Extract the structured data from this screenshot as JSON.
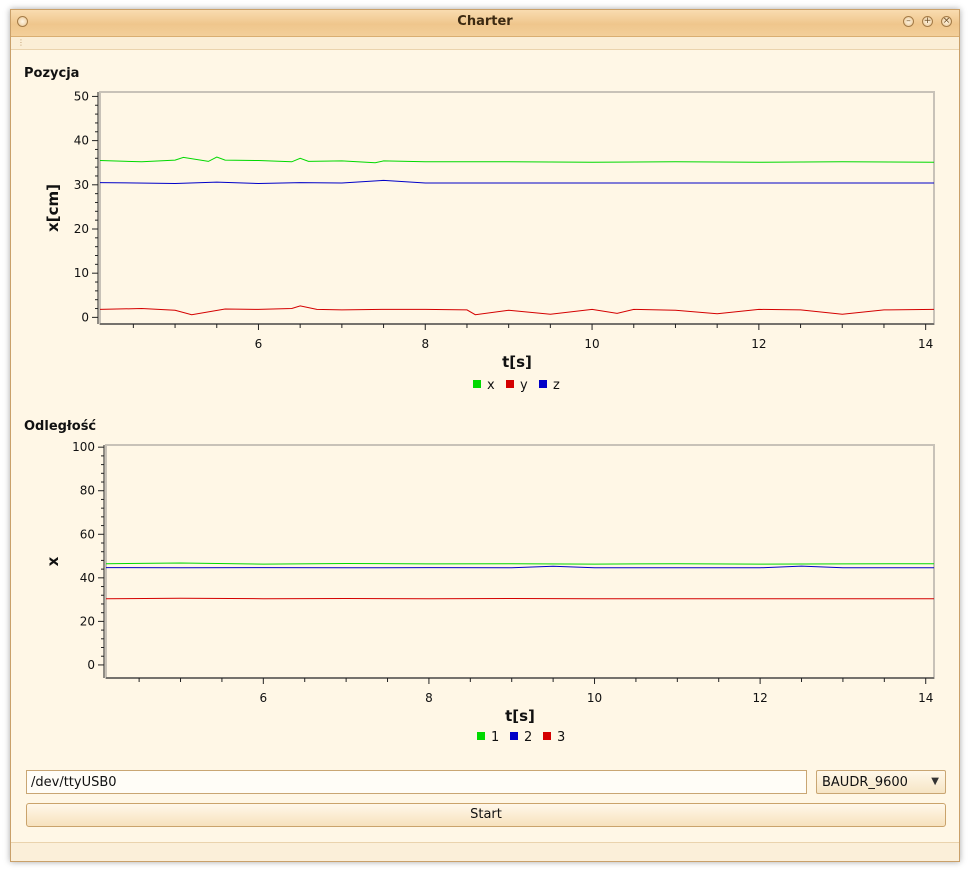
{
  "window": {
    "title": "Charter"
  },
  "colors": {
    "green": "#00d900",
    "red": "#d40000",
    "blue": "#0000c8",
    "axis": "#222222",
    "frame": "#c8c2b8"
  },
  "top_chart": {
    "section_label": "Pozycja",
    "chart_data": {
      "type": "line",
      "title": "",
      "xlabel": "t[s]",
      "ylabel": "x[cm]",
      "xlim": [
        4.1,
        14.1
      ],
      "ylim": [
        -1.5,
        51
      ],
      "x_ticks": [
        6,
        8,
        10,
        12,
        14
      ],
      "y_ticks": [
        0,
        10,
        20,
        30,
        40,
        50
      ],
      "legend": "bottom",
      "series": [
        {
          "name": "x",
          "color": "#00d900",
          "x": [
            4.1,
            4.6,
            5.0,
            5.1,
            5.4,
            5.5,
            5.6,
            6.0,
            6.4,
            6.5,
            6.6,
            7.0,
            7.4,
            7.5,
            8.0,
            9.0,
            10.0,
            11.0,
            12.0,
            13.0,
            14.1
          ],
          "y": [
            35.5,
            35.2,
            35.6,
            36.2,
            35.3,
            36.3,
            35.6,
            35.5,
            35.2,
            36.0,
            35.3,
            35.4,
            35.0,
            35.4,
            35.2,
            35.2,
            35.1,
            35.2,
            35.1,
            35.2,
            35.1
          ]
        },
        {
          "name": "y",
          "color": "#d40000",
          "x": [
            4.1,
            4.6,
            5.0,
            5.2,
            5.6,
            6.0,
            6.4,
            6.5,
            6.7,
            7.0,
            7.5,
            8.0,
            8.5,
            8.6,
            9.0,
            9.5,
            10.0,
            10.3,
            10.5,
            11.0,
            11.5,
            12.0,
            12.5,
            13.0,
            13.5,
            14.1
          ],
          "y": [
            1.8,
            2.0,
            1.6,
            0.6,
            1.9,
            1.8,
            2.0,
            2.6,
            1.8,
            1.7,
            1.8,
            1.8,
            1.7,
            0.6,
            1.6,
            0.7,
            1.8,
            0.9,
            1.8,
            1.6,
            0.8,
            1.8,
            1.7,
            0.7,
            1.7,
            1.8
          ]
        },
        {
          "name": "z",
          "color": "#0000c8",
          "x": [
            4.1,
            5.0,
            5.5,
            6.0,
            6.5,
            7.0,
            7.5,
            8.0,
            9.0,
            10.0,
            11.0,
            12.0,
            13.0,
            14.1
          ],
          "y": [
            30.5,
            30.3,
            30.6,
            30.3,
            30.5,
            30.4,
            31.0,
            30.4,
            30.4,
            30.4,
            30.4,
            30.4,
            30.4,
            30.4
          ]
        }
      ]
    }
  },
  "bottom_chart": {
    "section_label": "Odległość",
    "chart_data": {
      "type": "line",
      "title": "",
      "xlabel": "t[s]",
      "ylabel": "x",
      "xlim": [
        4.1,
        14.1
      ],
      "ylim": [
        -6,
        101
      ],
      "x_ticks": [
        6,
        8,
        10,
        12,
        14
      ],
      "y_ticks": [
        0,
        20,
        40,
        60,
        80,
        100
      ],
      "legend": "bottom",
      "series": [
        {
          "name": "1",
          "color": "#00d900",
          "x": [
            4.1,
            5.0,
            6.0,
            7.0,
            8.0,
            9.0,
            10.0,
            11.0,
            12.0,
            13.0,
            14.1
          ],
          "y": [
            46.5,
            46.8,
            46.3,
            46.6,
            46.4,
            46.5,
            46.3,
            46.5,
            46.3,
            46.4,
            46.5
          ]
        },
        {
          "name": "2",
          "color": "#0000c8",
          "x": [
            4.1,
            5.0,
            6.0,
            7.0,
            8.0,
            9.0,
            9.5,
            10.0,
            11.0,
            12.0,
            12.5,
            13.0,
            14.1
          ],
          "y": [
            44.7,
            44.6,
            44.7,
            44.6,
            44.7,
            44.6,
            45.3,
            44.6,
            44.6,
            44.6,
            45.4,
            44.6,
            44.6
          ]
        },
        {
          "name": "3",
          "color": "#d40000",
          "x": [
            4.1,
            5.0,
            6.0,
            7.0,
            8.0,
            9.0,
            10.0,
            11.0,
            12.0,
            13.0,
            14.1
          ],
          "y": [
            30.4,
            30.6,
            30.4,
            30.5,
            30.4,
            30.5,
            30.4,
            30.4,
            30.4,
            30.4,
            30.4
          ]
        }
      ]
    }
  },
  "controls": {
    "port_value": "/dev/ttyUSB0",
    "baud_selected": "BAUDR_9600",
    "start_label": "Start"
  }
}
